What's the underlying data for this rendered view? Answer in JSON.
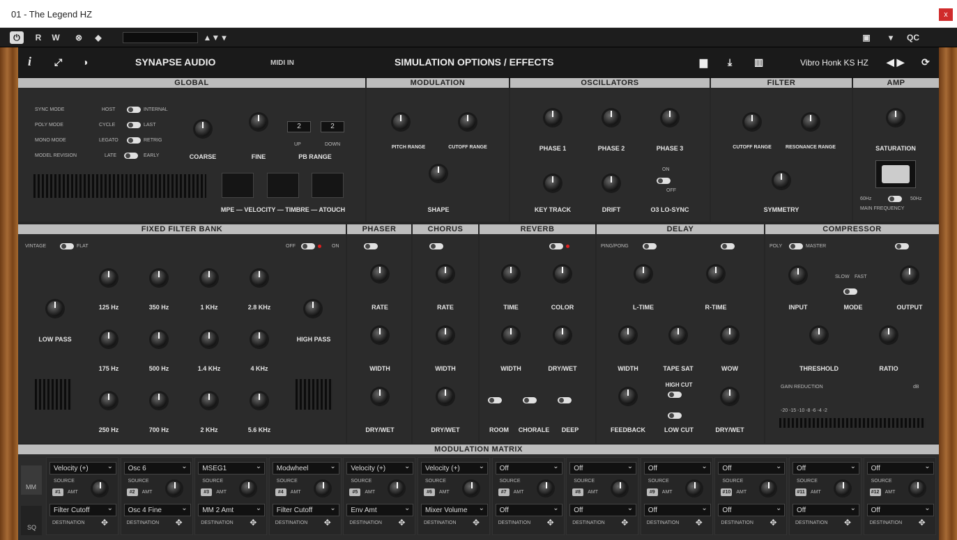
{
  "window": {
    "title": "01 - The Legend HZ",
    "close": "x"
  },
  "toolbar": {
    "power": "⏻",
    "r": "R",
    "w": "W",
    "qc": "QC"
  },
  "header": {
    "info": "i",
    "expand": "⤢",
    "theme": "◑",
    "brand": "SYNAPSE AUDIO",
    "midi": "MIDI IN",
    "title": "SIMULATION OPTIONS / EFFECTS",
    "preset": "Vibro Honk KS HZ"
  },
  "sections": {
    "global": "GLOBAL",
    "modulation": "MODULATION",
    "oscillators": "OSCILLATORS",
    "filter": "FILTER",
    "amp": "AMP",
    "ffb": "FIXED FILTER BANK",
    "phaser": "PHASER",
    "chorus": "CHORUS",
    "reverb": "REVERB",
    "delay": "DELAY",
    "compressor": "COMPRESSOR",
    "matrix": "MODULATION MATRIX"
  },
  "global": {
    "sync": "SYNC MODE",
    "host": "HOST",
    "internal": "INTERNAL",
    "poly": "POLY MODE",
    "cycle": "CYCLE",
    "last": "LAST",
    "mono": "MONO MODE",
    "legato": "LEGATO",
    "retrig": "RETRIG",
    "model": "MODEL REVISION",
    "late": "LATE",
    "early": "EARLY",
    "coarse": "COARSE",
    "fine": "FINE",
    "pbrange": "PB RANGE",
    "up": "UP",
    "down": "DOWN",
    "upval": "2",
    "downval": "2",
    "mpe": "MPE — VELOCITY — TIMBRE — ATOUCH"
  },
  "modulation": {
    "pitch": "PITCH RANGE",
    "cutoff": "CUTOFF RANGE",
    "shape": "SHAPE"
  },
  "osc": {
    "p1": "PHASE 1",
    "p2": "PHASE 2",
    "p3": "PHASE 3",
    "key": "KEY TRACK",
    "drift": "DRIFT",
    "lo": "O3 LO-SYNC",
    "on": "ON",
    "off": "OFF"
  },
  "filter": {
    "cutoff": "CUTOFF RANGE",
    "res": "RESONANCE RANGE",
    "sym": "SYMMETRY"
  },
  "amp": {
    "sat": "SATURATION",
    "f60": "60Hz",
    "f50": "50Hz",
    "main": "MAIN FREQUENCY"
  },
  "ffb": {
    "vintage": "VINTAGE",
    "flat": "FLAT",
    "off": "OFF",
    "on": "ON",
    "lowpass": "LOW PASS",
    "highpass": "HIGH PASS",
    "bands": [
      "125 Hz",
      "350 Hz",
      "1 KHz",
      "2.8 KHz",
      "175 Hz",
      "500 Hz",
      "1.4 KHz",
      "4 KHz",
      "250 Hz",
      "700 Hz",
      "2 KHz",
      "5.6 KHz"
    ]
  },
  "phaser": {
    "rate": "RATE",
    "width": "WIDTH",
    "drywet": "DRY/WET"
  },
  "chorus": {
    "rate": "RATE",
    "width": "WIDTH",
    "drywet": "DRY/WET"
  },
  "reverb": {
    "time": "TIME",
    "color": "COLOR",
    "width": "WIDTH",
    "drywet": "DRY/WET",
    "room": "ROOM",
    "chorale": "CHORALE",
    "deep": "DEEP"
  },
  "delay": {
    "pingpong": "PING/PONG",
    "ltime": "L-TIME",
    "rtime": "R-TIME",
    "width": "WIDTH",
    "tapesat": "TAPE SAT",
    "wow": "WOW",
    "feedback": "FEEDBACK",
    "highcut": "HIGH CUT",
    "lowcut": "LOW CUT",
    "drywet": "DRY/WET"
  },
  "comp": {
    "poly": "POLY",
    "master": "MASTER",
    "input": "INPUT",
    "mode": "MODE",
    "slow": "SLOW",
    "fast": "FAST",
    "output": "OUTPUT",
    "threshold": "THRESHOLD",
    "ratio": "RATIO",
    "gr": "GAIN REDUCTION",
    "db": "dB",
    "scale": "-20   -15   -10    -8     -6     -4     -2"
  },
  "matrix": {
    "mm": "MM",
    "sq": "SQ",
    "source": "SOURCE",
    "amt": "AMT",
    "dest": "DESTINATION",
    "slots": [
      {
        "n": "#1",
        "src": "Velocity (+)",
        "dst": "Filter Cutoff"
      },
      {
        "n": "#2",
        "src": "Osc 6",
        "dst": "Osc 4 Fine"
      },
      {
        "n": "#3",
        "src": "MSEG1",
        "dst": "MM 2 Amt"
      },
      {
        "n": "#4",
        "src": "Modwheel",
        "dst": "Filter Cutoff"
      },
      {
        "n": "#5",
        "src": "Velocity (+)",
        "dst": "Env Amt"
      },
      {
        "n": "#6",
        "src": "Velocity (+)",
        "dst": "Mixer Volume"
      },
      {
        "n": "#7",
        "src": "Off",
        "dst": "Off"
      },
      {
        "n": "#8",
        "src": "Off",
        "dst": "Off"
      },
      {
        "n": "#9",
        "src": "Off",
        "dst": "Off"
      },
      {
        "n": "#10",
        "src": "Off",
        "dst": "Off"
      },
      {
        "n": "#11",
        "src": "Off",
        "dst": "Off"
      },
      {
        "n": "#12",
        "src": "Off",
        "dst": "Off"
      }
    ]
  }
}
